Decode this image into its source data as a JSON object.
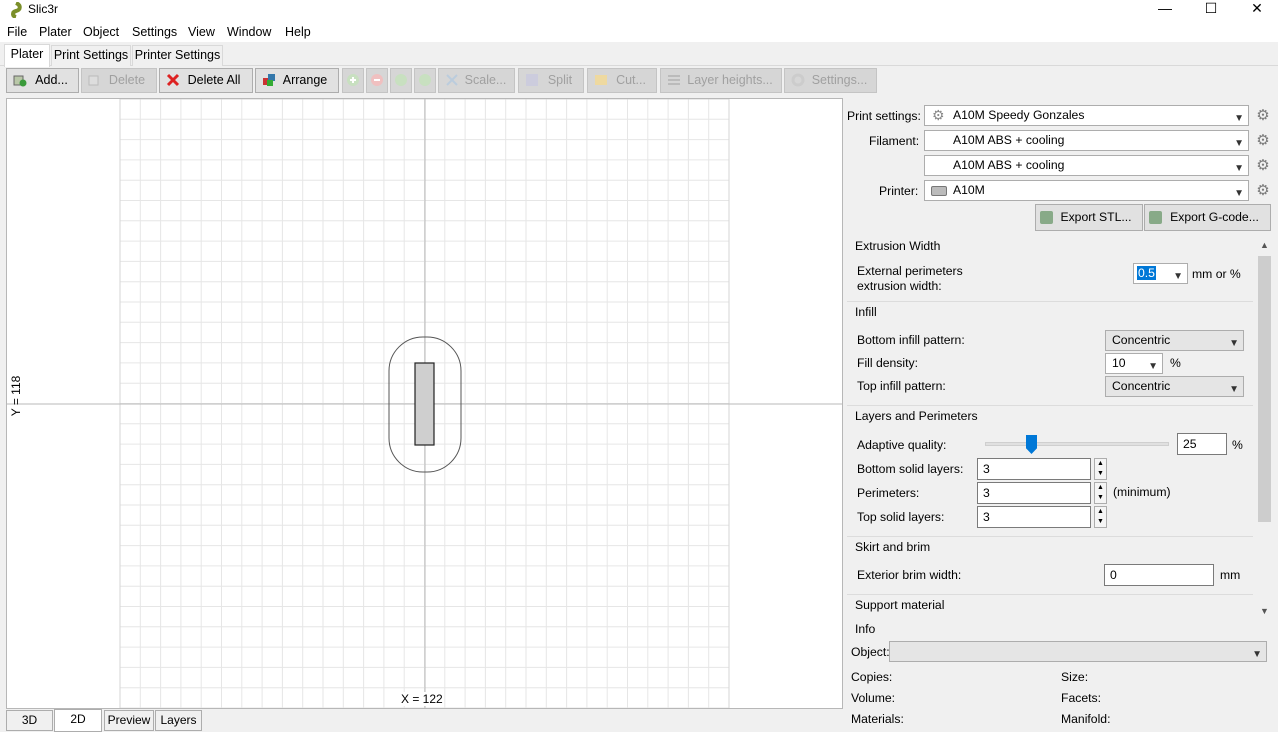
{
  "window": {
    "title": "Slic3r",
    "minimize": "—",
    "maximize": "☐",
    "close": "✕"
  },
  "menu": [
    "File",
    "Plater",
    "Object",
    "Settings",
    "View",
    "Window",
    "Help"
  ],
  "tabs": [
    "Plater",
    "Print Settings",
    "Printer Settings"
  ],
  "toolbar": {
    "add": "Add...",
    "delete": "Delete",
    "delete_all": "Delete All",
    "arrange": "Arrange",
    "scale": "Scale...",
    "split": "Split",
    "cut": "Cut...",
    "layer_heights": "Layer heights...",
    "settings": "Settings..."
  },
  "canvas": {
    "x_label": "X = 122",
    "y_label": "Y = 118"
  },
  "view_tabs": [
    "3D",
    "2D",
    "Preview",
    "Layers"
  ],
  "presets": {
    "print_label": "Print settings:",
    "print_value": "A10M Speedy Gonzales",
    "filament_label": "Filament:",
    "filament_value_1": "A10M ABS + cooling",
    "filament_value_2": "A10M ABS + cooling",
    "printer_label": "Printer:",
    "printer_value": "A10M",
    "export_stl": "Export STL...",
    "export_gcode": "Export G-code..."
  },
  "settings": {
    "extrusion_width": {
      "title": "Extrusion Width",
      "ext_label_1": "External perimeters",
      "ext_label_2": "extrusion width:",
      "ext_value": "0.5",
      "ext_unit": "mm or %"
    },
    "infill": {
      "title": "Infill",
      "bottom_label": "Bottom infill pattern:",
      "bottom_value": "Concentric",
      "density_label": "Fill density:",
      "density_value": "10",
      "density_unit": "%",
      "top_label": "Top infill pattern:",
      "top_value": "Concentric"
    },
    "layers": {
      "title": "Layers and Perimeters",
      "adaptive_label": "Adaptive quality:",
      "adaptive_value": "25",
      "adaptive_level": 0.25,
      "adaptive_unit": "%",
      "bottom_label": "Bottom solid layers:",
      "bottom_value": "3",
      "perimeters_label": "Perimeters:",
      "perimeters_value": "3",
      "perimeters_note": "(minimum)",
      "top_label": "Top solid layers:",
      "top_value": "3"
    },
    "skirt": {
      "title": "Skirt and brim",
      "brim_label": "Exterior brim width:",
      "brim_value": "0",
      "brim_unit": "mm"
    },
    "support": {
      "title": "Support material"
    }
  },
  "info": {
    "title": "Info",
    "object_label": "Object:",
    "copies": "Copies:",
    "size": "Size:",
    "volume": "Volume:",
    "facets": "Facets:",
    "materials": "Materials:",
    "manifold": "Manifold:"
  }
}
